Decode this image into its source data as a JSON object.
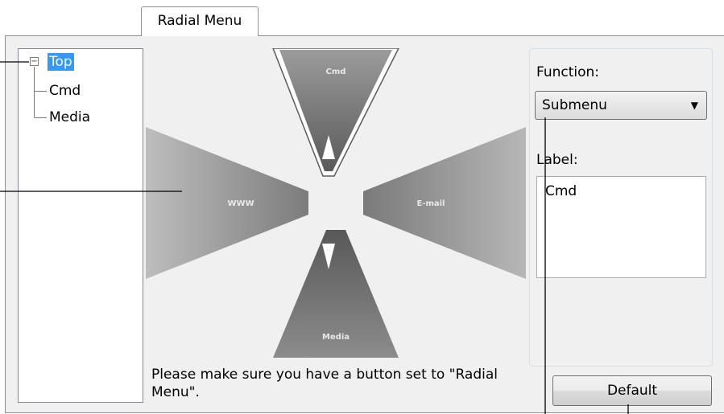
{
  "tab": {
    "label": "Radial Menu"
  },
  "tree": {
    "expander_symbol": "−",
    "items": [
      {
        "label": "Top",
        "selected": true
      },
      {
        "label": "Cmd",
        "selected": false
      },
      {
        "label": "Media",
        "selected": false
      }
    ]
  },
  "preview": {
    "segments": {
      "top": "Cmd",
      "left": "WWW",
      "right": "E-mail",
      "bottom": "Media"
    }
  },
  "note": "Please make sure you have a button set to \"Radial Menu\".",
  "function": {
    "label": "Function:",
    "value": "Submenu"
  },
  "label_field": {
    "label": "Label:",
    "value": "Cmd"
  },
  "default_button": {
    "label": "Default"
  }
}
